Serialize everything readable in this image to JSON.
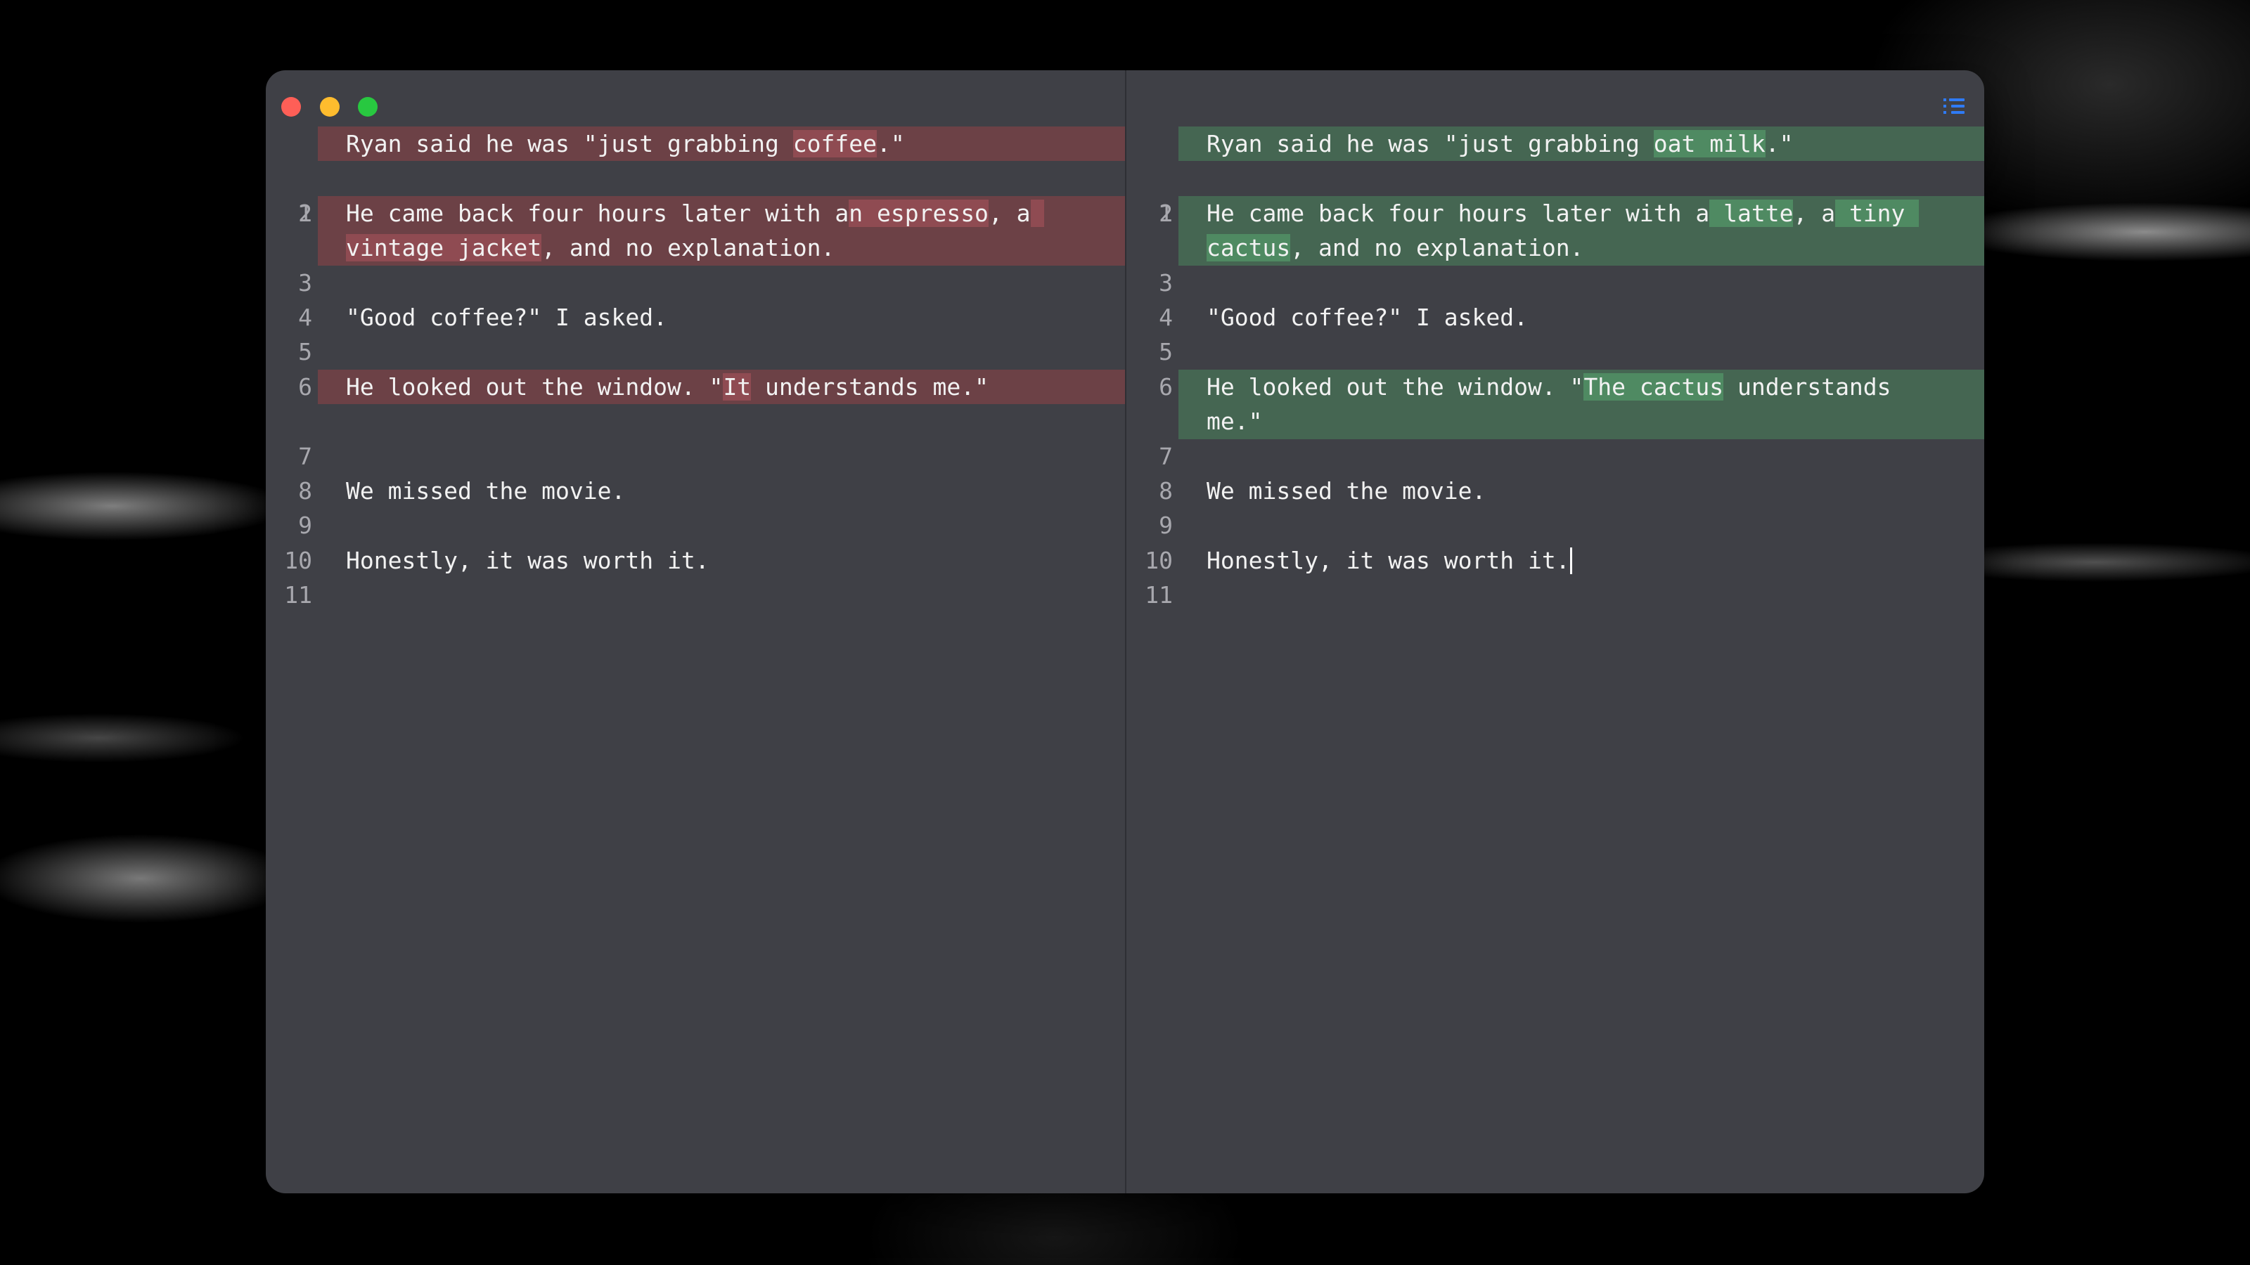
{
  "window": {
    "controls": [
      "close",
      "minimize",
      "maximize"
    ],
    "toolbar_icon": "list-icon",
    "accent_color": "#2f7bf6"
  },
  "left": {
    "line_numbers": [
      "1",
      "2",
      "3",
      "",
      "4",
      "5",
      "6",
      "7",
      "",
      "8",
      "9",
      "10",
      "11"
    ],
    "lines": [
      {
        "a": "Ryan said he was \"just grabbing ",
        "del": "coffee",
        "b": ".\""
      },
      {
        "a": ""
      },
      {
        "a": "He came back four hours later with a",
        "del": "n espresso",
        "b": ", a",
        "del2": " "
      },
      {
        "del": "vintage jacket",
        "b": ", and no explanation."
      },
      {
        "a": ""
      },
      {
        "a": "\"Good coffee?\" I asked."
      },
      {
        "a": ""
      },
      {
        "a": "He looked out the window. \"",
        "del": "It",
        "b": " understands me.\""
      },
      {
        "a": ""
      },
      {
        "a": ""
      },
      {
        "a": "We missed the movie."
      },
      {
        "a": ""
      },
      {
        "a": "Honestly, it was worth it."
      }
    ]
  },
  "right": {
    "line_numbers": [
      "1",
      "2",
      "3",
      "",
      "4",
      "5",
      "6",
      "7",
      "",
      "8",
      "9",
      "10",
      "11"
    ],
    "lines": [
      {
        "a": "Ryan said he was \"just grabbing ",
        "ins": "oat milk",
        "b": ".\""
      },
      {
        "a": ""
      },
      {
        "a": "He came back four hours later with a",
        "ins": " latte",
        "b": ", a",
        "ins2": " tiny "
      },
      {
        "ins": "cactus",
        "b": ", and no explanation."
      },
      {
        "a": ""
      },
      {
        "a": "\"Good coffee?\" I asked."
      },
      {
        "a": ""
      },
      {
        "a": "He looked out the window. \"",
        "ins": "The cactus",
        "b": " understands"
      },
      {
        "a": "me.\""
      },
      {
        "a": ""
      },
      {
        "a": "We missed the movie."
      },
      {
        "a": ""
      },
      {
        "a": "Honestly, it was worth it."
      }
    ]
  }
}
